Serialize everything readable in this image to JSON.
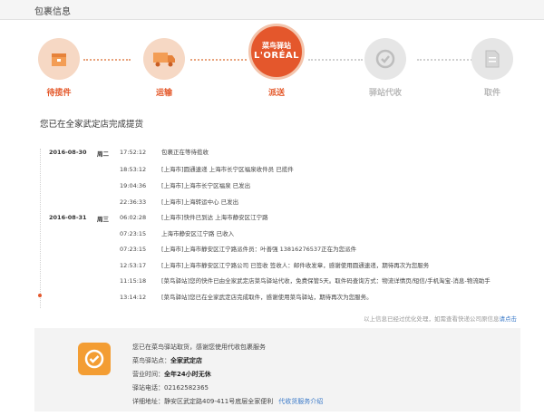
{
  "header": {
    "title": "包裹信息"
  },
  "steps": [
    {
      "label": "待揽件",
      "state": "done",
      "icon": "package-icon"
    },
    {
      "label": "运输",
      "state": "done",
      "icon": "truck-icon"
    },
    {
      "label": "派送",
      "state": "active",
      "icon": "cainiao-loreal-logo",
      "logo_top": "菜鸟驿站",
      "logo_bottom": "L'ORÉAL"
    },
    {
      "label": "驿站代收",
      "state": "pending",
      "icon": "station-icon"
    },
    {
      "label": "取件",
      "state": "pending",
      "icon": "pickup-icon"
    }
  ],
  "status": "您已在全家武定店完成提货",
  "tracking": [
    {
      "date": "2016-08-30",
      "weekday": "周二",
      "time": "17:52:12",
      "msg": "包裹正在等待揽收"
    },
    {
      "date": "",
      "weekday": "",
      "time": "18:53:12",
      "msg": "[上海市]圆通速递 上海市长宁区福泉收件员 已揽件"
    },
    {
      "date": "",
      "weekday": "",
      "time": "19:04:36",
      "msg": "[上海市]上海市长宁区福泉 已发出"
    },
    {
      "date": "",
      "weekday": "",
      "time": "22:36:33",
      "msg": "[上海市]上海转运中心 已发出"
    },
    {
      "date": "2016-08-31",
      "weekday": "周三",
      "time": "06:02:28",
      "msg": "[上海市]快件已到达 上海市静安区江宁路"
    },
    {
      "date": "",
      "weekday": "",
      "time": "07:23:15",
      "msg": "上海市静安区江宁路 已收入"
    },
    {
      "date": "",
      "weekday": "",
      "time": "07:23:15",
      "msg": "[上海市]上海市静安区江宁路派件员：叶善强 13816276537正在为您派件"
    },
    {
      "date": "",
      "weekday": "",
      "time": "12:53:17",
      "msg": "[上海市]上海市静安区江宁路公司 已签收 签收人：邮件收发章，感谢使用圆通速递，期待再次为您服务"
    },
    {
      "date": "",
      "weekday": "",
      "time": "11:15:18",
      "msg": "[菜鸟驿站]您的快件已由全家武定店菜鸟驿站代收，免费保管5天。取件码查询方式：物流详情页/短信/手机淘宝-消息-物流助手"
    },
    {
      "date": "",
      "weekday": "",
      "time": "13:14:12",
      "msg": "[菜鸟驿站]您已在全家武定店完成取件，感谢使用菜鸟驿站，期待再次为您服务。"
    }
  ],
  "note": {
    "text": "以上信息已经过优化处理，如需查看快递公司原信息",
    "link": "请点击"
  },
  "station": {
    "intro": "您已在菜鸟驿站取货，感谢您使用代收包裹服务",
    "name_label": "菜鸟驿站点：",
    "name_value": "全家武定店",
    "hours_label": "营业时间：",
    "hours_value": "全年24小时无休",
    "phone_label": "驿站电话：",
    "phone_value": "02162582365",
    "addr_label": "详细地址：",
    "addr_value": "静安区武定路409-411号底层全家便利",
    "service_link": "代收货服务介绍"
  },
  "colors": {
    "accent": "#e4572c",
    "inactive": "#b8b8b8",
    "link": "#3a79c8"
  }
}
